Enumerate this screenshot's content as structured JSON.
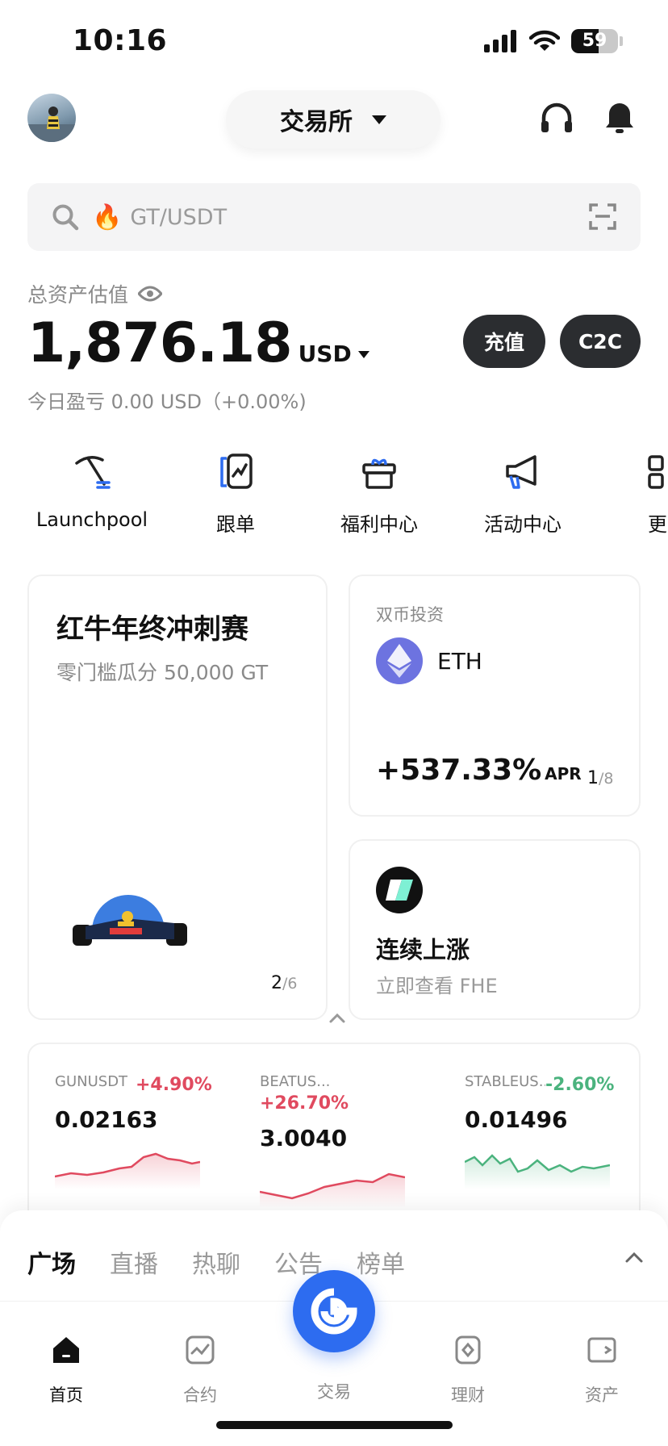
{
  "status": {
    "time": "10:16",
    "battery": "59",
    "battery_level": 59
  },
  "header": {
    "exchange_label": "交易所"
  },
  "search": {
    "placeholder": "GT/USDT"
  },
  "assets": {
    "label": "总资产估值",
    "value": "1,876.18",
    "unit": "USD",
    "pnl": "今日盈亏 0.00 USD（+0.00%)",
    "deposit_label": "充值",
    "c2c_label": "C2C"
  },
  "quick": [
    {
      "label": "Launchpool",
      "icon": "pickaxe-icon"
    },
    {
      "label": "跟单",
      "icon": "copy-trade-icon"
    },
    {
      "label": "福利中心",
      "icon": "gift-icon"
    },
    {
      "label": "活动中心",
      "icon": "megaphone-icon"
    },
    {
      "label": "更",
      "icon": "grid-icon"
    }
  ],
  "promo": {
    "title": "红牛年终冲刺赛",
    "subtitle": "零门槛瓜分 50,000 GT",
    "page": "2",
    "total": "/6"
  },
  "dual": {
    "label": "双币投资",
    "coin": "ETH",
    "apr": "+537.33%",
    "apr_unit": "APR",
    "page": "1",
    "total": "/8"
  },
  "rise": {
    "title": "连续上涨",
    "subtitle": "立即查看 FHE"
  },
  "tickers": [
    {
      "symbol": "GUNUSDT",
      "change": "+4.90%",
      "price": "0.02163",
      "trend": "up"
    },
    {
      "symbol": "BEATUS...",
      "change": "+26.70%",
      "price": "3.0040",
      "trend": "up"
    },
    {
      "symbol": "STABLEUS...",
      "change": "-2.60%",
      "price": "0.01496",
      "trend": "down"
    }
  ],
  "feed_tabs": [
    "广场",
    "直播",
    "热聊",
    "公告",
    "榜单"
  ],
  "nav": {
    "home": "首页",
    "futures": "合约",
    "trade": "交易",
    "earn": "理财",
    "assets": "资产"
  },
  "colors": {
    "accent": "#2d6cf0",
    "up": "#e04a5f",
    "down": "#4bb37e",
    "dark_button": "#2b2d30"
  }
}
